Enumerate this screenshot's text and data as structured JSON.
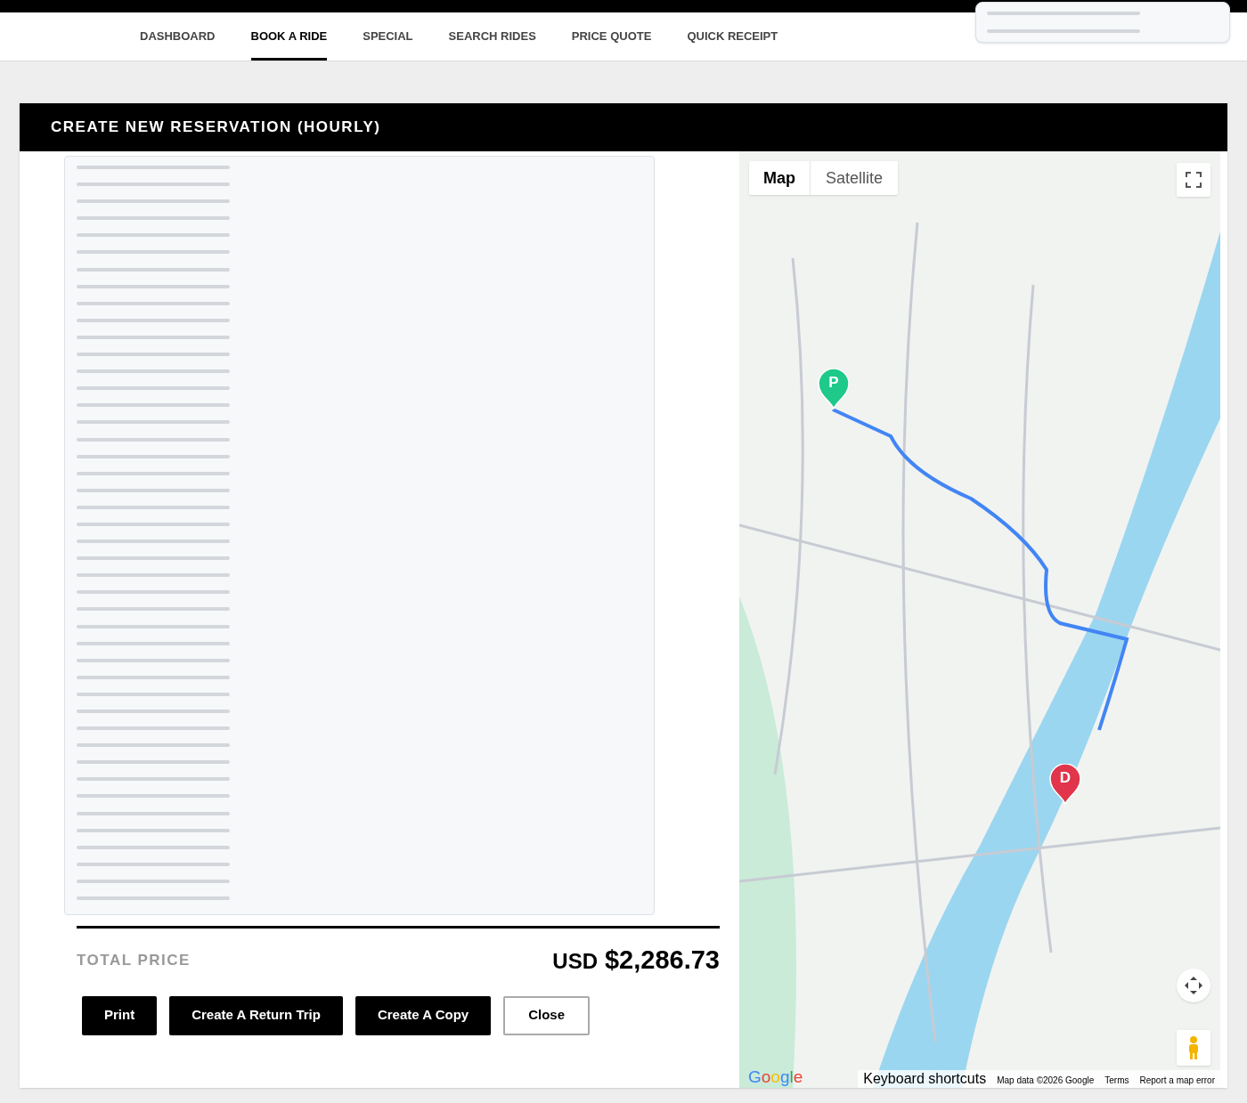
{
  "top_nav": {
    "tabs": [
      {
        "label": "DASHBOARD",
        "selected": false
      },
      {
        "label": "BOOK A RIDE",
        "selected": true
      },
      {
        "label": "SPECIAL",
        "selected": false
      },
      {
        "label": "SEARCH RIDES",
        "selected": false
      },
      {
        "label": "PRICE QUOTE",
        "selected": false
      },
      {
        "label": "QUICK RECEIPT",
        "selected": false
      }
    ]
  },
  "reservation": {
    "title": "CREATE NEW RESERVATION (HOURLY)",
    "total_price": {
      "label": "TOTAL PRICE",
      "currency": "USD",
      "amount": "$2,286.73"
    },
    "buttons": [
      {
        "label": "Print",
        "kind": "primary"
      },
      {
        "label": "Create A Return Trip",
        "kind": "primary"
      },
      {
        "label": "Create A Copy",
        "kind": "primary"
      },
      {
        "label": "Close",
        "kind": "outline"
      }
    ]
  },
  "map": {
    "type_toggle": [
      {
        "label": "Map",
        "selected": true
      },
      {
        "label": "Satellite",
        "selected": false
      }
    ],
    "markers": [
      {
        "label": "P",
        "color": "#1ec98a"
      },
      {
        "label": "D",
        "color": "#e0354b"
      }
    ],
    "logo": "Google",
    "attribution": [
      "Keyboard shortcuts",
      "Map data ©2026 Google",
      "Terms",
      "Report a map error"
    ]
  }
}
